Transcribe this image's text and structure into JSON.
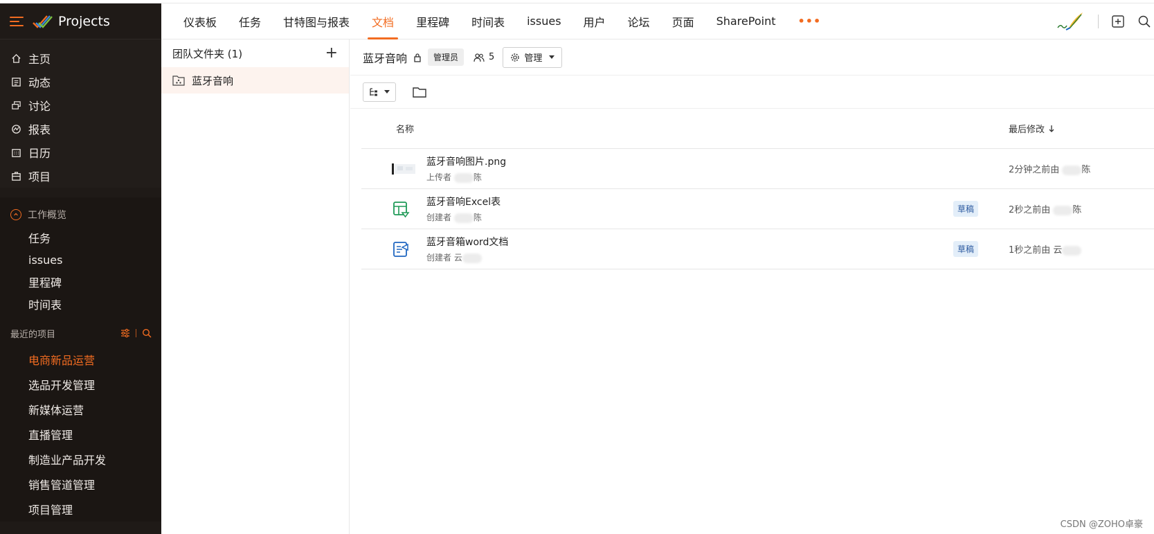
{
  "app": {
    "title": "Projects"
  },
  "sidebar": {
    "nav": [
      {
        "label": "主页",
        "icon": "home-icon"
      },
      {
        "label": "动态",
        "icon": "feed-icon"
      },
      {
        "label": "讨论",
        "icon": "discussion-icon"
      },
      {
        "label": "报表",
        "icon": "reports-icon"
      },
      {
        "label": "日历",
        "icon": "calendar-icon"
      },
      {
        "label": "项目",
        "icon": "projects-icon"
      }
    ],
    "overview": {
      "title": "工作概览",
      "items": [
        "任务",
        "issues",
        "里程碑",
        "时间表"
      ]
    },
    "recent": {
      "title": "最近的项目",
      "projects": [
        "电商新品运营",
        "选品开发管理",
        "新媒体运营",
        "直播管理",
        "制造业产品开发",
        "销售管道管理",
        "项目管理"
      ],
      "active_index": 0
    }
  },
  "topbar": {
    "tabs": [
      "仪表板",
      "任务",
      "甘特图与报表",
      "文档",
      "里程碑",
      "时间表",
      "issues",
      "用户",
      "论坛",
      "页面",
      "SharePoint"
    ],
    "active_tab": "文档",
    "more": "•••"
  },
  "folders": {
    "header": "团队文件夹",
    "count": "(1)",
    "items": [
      "蓝牙音响"
    ]
  },
  "main": {
    "title": "蓝牙音响",
    "role_badge": "管理员",
    "members": "5",
    "manage_label": "管理",
    "columns": {
      "name": "名称",
      "modified": "最后修改"
    },
    "rows": [
      {
        "name": "蓝牙音响图片.png",
        "by_label": "上传者",
        "by_tail": "陈",
        "status": "",
        "modified": "2分钟之前由",
        "modified_tail": "陈"
      },
      {
        "name": "蓝牙音响Excel表",
        "by_label": "创建者",
        "by_tail": "陈",
        "status": "草稿",
        "modified": "2秒之前由",
        "modified_tail": "陈"
      },
      {
        "name": "蓝牙音箱word文档",
        "by_label": "创建者",
        "by_tail": "云",
        "status": "草稿",
        "modified": "1秒之前由",
        "modified_tail": "云"
      }
    ]
  },
  "watermark": "CSDN @ZOHO卓豪",
  "colors": {
    "accent": "#f26c21",
    "sidebar_bg": "#1f1a17",
    "draft_bg": "#e3eef9",
    "draft_text": "#2c5aa0"
  }
}
